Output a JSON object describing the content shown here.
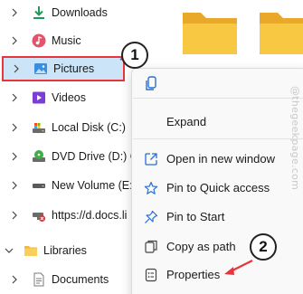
{
  "nav": {
    "items": [
      {
        "label": "Downloads"
      },
      {
        "label": "Music"
      },
      {
        "label": "Pictures"
      },
      {
        "label": "Videos"
      },
      {
        "label": "Local Disk (C:)"
      },
      {
        "label": "DVD Drive (D:) C"
      },
      {
        "label": "New Volume (E:)"
      },
      {
        "label": "https://d.docs.li"
      },
      {
        "label": "Libraries"
      },
      {
        "label": "Documents"
      }
    ]
  },
  "menu": {
    "items": [
      {
        "label": "Expand"
      },
      {
        "label": "Open in new window"
      },
      {
        "label": "Pin to Quick access"
      },
      {
        "label": "Pin to Start"
      },
      {
        "label": "Copy as path"
      },
      {
        "label": "Properties"
      }
    ]
  },
  "callouts": {
    "one": "1",
    "two": "2"
  },
  "watermark": "@thegeekpage.com",
  "colors": {
    "selection": "#cce4f7",
    "highlight_border": "#e8353b",
    "arrow": "#e8353b",
    "folder": "#f8c843"
  }
}
